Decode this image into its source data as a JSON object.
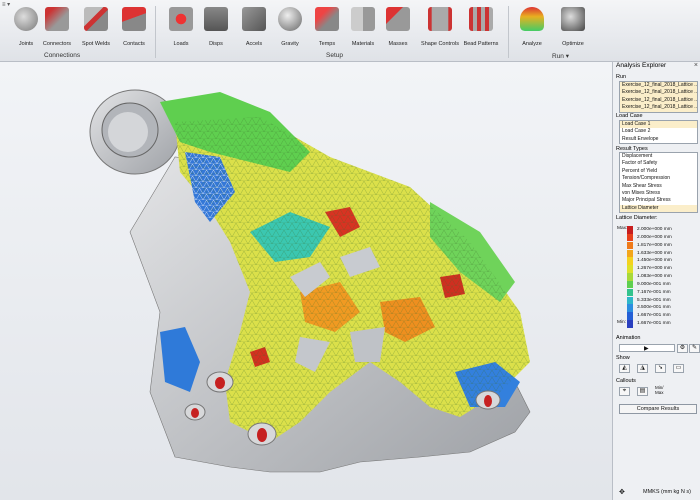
{
  "ribbon": {
    "quick_access": "≡ ▾",
    "buttons": [
      {
        "label": "Joints",
        "icon": "joints-icon"
      },
      {
        "label": "Connectors",
        "icon": "connectors-icon"
      },
      {
        "label": "Spot Welds",
        "icon": "spot-welds-icon"
      },
      {
        "label": "Contacts",
        "icon": "contacts-icon"
      },
      {
        "label": "Loads",
        "icon": "loads-icon"
      },
      {
        "label": "Disps",
        "icon": "disps-icon"
      },
      {
        "label": "Accels",
        "icon": "accels-icon"
      },
      {
        "label": "Gravity",
        "icon": "gravity-icon"
      },
      {
        "label": "Temps",
        "icon": "temps-icon"
      },
      {
        "label": "Materials",
        "icon": "materials-icon"
      },
      {
        "label": "Masses",
        "icon": "masses-icon"
      },
      {
        "label": "Shape Controls",
        "icon": "shape-controls-icon"
      },
      {
        "label": "Bead Patterns",
        "icon": "bead-patterns-icon"
      },
      {
        "label": "Analyze",
        "icon": "analyze-icon"
      },
      {
        "label": "Optimize",
        "icon": "optimize-icon"
      }
    ],
    "groups": {
      "connections": "Connections",
      "setup": "Setup",
      "run": "Run ▾"
    }
  },
  "explorer": {
    "title": "Analysis Explorer",
    "close": "×",
    "run_label": "Run",
    "runs": [
      "Exercise_12_final_2018_Lattice ...",
      "Exercise_12_final_2018_Lattice ...",
      "Exercise_12_final_2018_Lattice ...",
      "Exercise_12_final_2018_Lattice ..."
    ],
    "load_case_label": "Load Case",
    "load_cases": [
      "Load Case 1",
      "Load Case 2",
      "Result Envelope"
    ],
    "result_types_label": "Result Types",
    "result_types": [
      "Displacement",
      "Factor of Safety",
      "Percent of Yield",
      "Tension/Compression",
      "Max Shear Stress",
      "von Mises Stress",
      "Major Principal Stress",
      "Lattice Diameter"
    ],
    "legend_label": "Lattice Diameter:",
    "legend_max": "Max:",
    "legend_min": "Min:",
    "legend_values": [
      "2.000e+000 mm",
      "2.000e+000 mm",
      "1.817e+000 mm",
      "1.633e+000 mm",
      "1.450e+000 mm",
      "1.267e+000 mm",
      "1.083e+000 mm",
      "9.000e-001 mm",
      "7.167e-001 mm",
      "5.333e-001 mm",
      "3.500e-001 mm",
      "1.667e-001 mm",
      "1.667e-001 mm"
    ],
    "legend_colors": [
      "#c81e1e",
      "#e8411c",
      "#ef7a1a",
      "#f3a61c",
      "#f4d21f",
      "#dde12a",
      "#a8d93a",
      "#5fcf4f",
      "#33c38d",
      "#2fb7c9",
      "#2c8ee0",
      "#2560d6",
      "#2a3fbf"
    ],
    "animation_label": "Animation",
    "show_label": "Show",
    "callouts_label": "Callouts",
    "callout_minmax": "Min/ Max",
    "compare_button": "Compare Results"
  },
  "status": {
    "units": "MMKS (mm kg N s)",
    "units_icon": "arrows-icon"
  }
}
